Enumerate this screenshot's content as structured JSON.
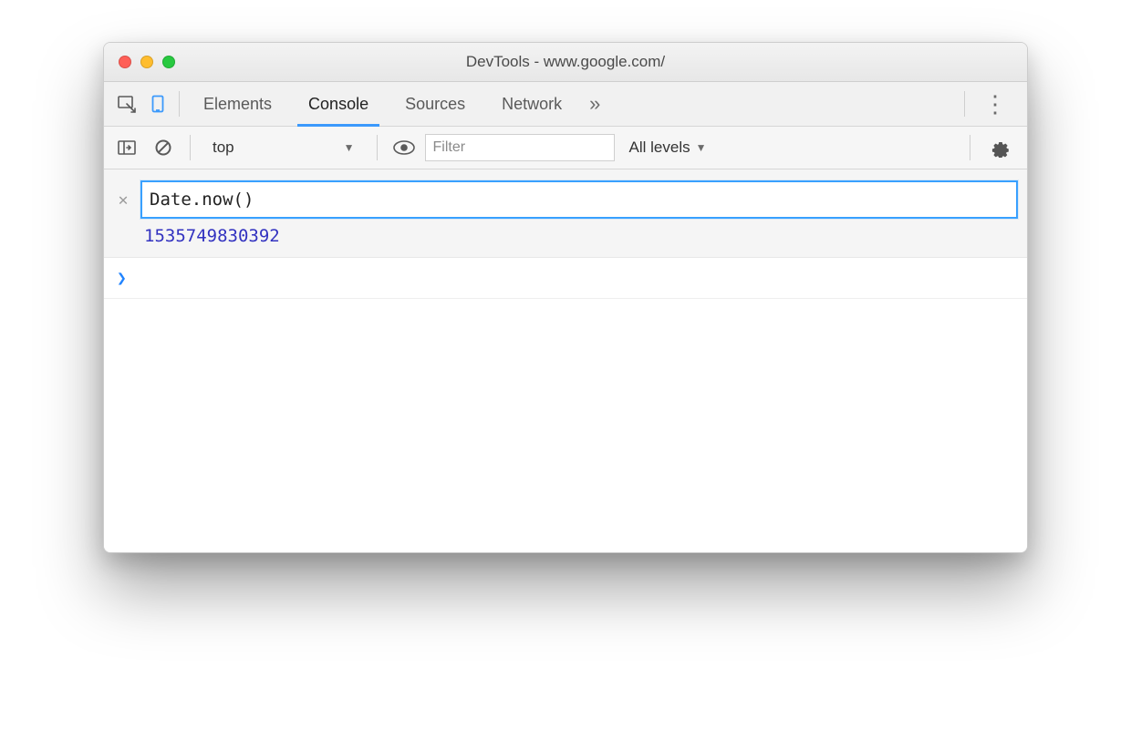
{
  "window": {
    "title": "DevTools - www.google.com/"
  },
  "tabs": {
    "items": [
      "Elements",
      "Console",
      "Sources",
      "Network"
    ],
    "active_index": 1,
    "overflow_glyph": "»"
  },
  "toolbar": {
    "context_label": "top",
    "filter_placeholder": "Filter",
    "levels_label": "All levels"
  },
  "console": {
    "eager_expression": "Date.now()",
    "eager_result": "1535749830392",
    "prompt_glyph": "❯"
  },
  "icons": {
    "inspect": "inspect-icon",
    "device": "device-icon",
    "show_drawer": "show-drawer-icon",
    "clear": "clear-icon",
    "eye": "eye-icon",
    "gear": "gear-icon",
    "kebab": "⋮"
  }
}
